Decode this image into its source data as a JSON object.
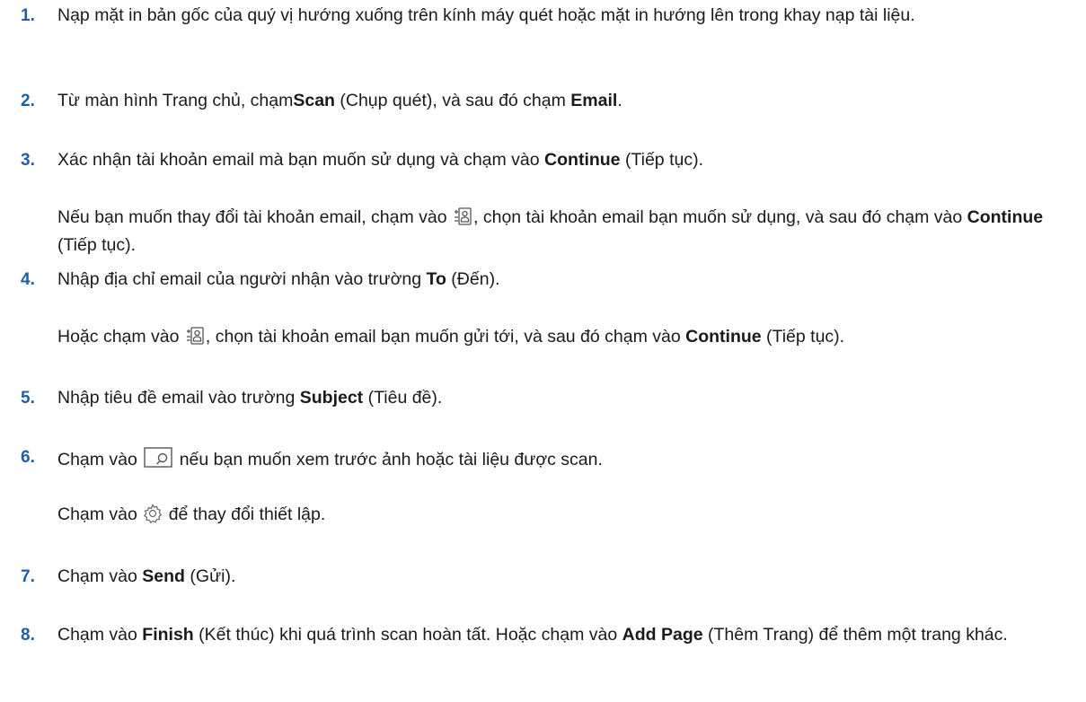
{
  "steps": [
    {
      "number": "1.",
      "text": "Nạp mặt in bản gốc của quý vị hướng xuống trên kính máy quét hoặc mặt in hướng lên trong khay nạp tài liệu."
    },
    {
      "number": "2.",
      "pre": "Từ màn hình Trang chủ, chạm",
      "scan": "Scan",
      "mid": " (Chụp quét), và sau đó chạm ",
      "email": "Email",
      "post": "."
    },
    {
      "number": "3.",
      "pre": "Xác nhận tài khoản email mà bạn muốn sử dụng và chạm vào ",
      "continue": "Continue",
      "post": " (Tiếp tục).",
      "sub_pre": "Nếu bạn muốn thay đổi tài khoản email, chạm vào ",
      "sub_icon": "contacts-icon",
      "sub_mid": ", chọn tài khoản email bạn muốn sử dụng, và sau đó chạm vào ",
      "sub_continue": "Continue",
      "sub_post": " (Tiếp tục)."
    },
    {
      "number": "4.",
      "pre": "Nhập địa chỉ email của người nhận vào trường ",
      "to": "To",
      "post": " (Đến).",
      "sub_pre": "Hoặc chạm vào ",
      "sub_icon": "contacts-icon",
      "sub_mid": ", chọn tài khoản email bạn muốn gửi tới, và sau đó chạm vào ",
      "sub_continue": "Continue",
      "sub_post": " (Tiếp tục)."
    },
    {
      "number": "5.",
      "pre": "Nhập tiêu đề email vào trường ",
      "subject": "Subject",
      "post": " (Tiêu đề)."
    },
    {
      "number": "6.",
      "pre": "Chạm vào ",
      "icon": "preview-icon",
      "post": " nếu bạn muốn xem trước ảnh hoặc tài liệu được scan.",
      "sub_pre": "Chạm vào ",
      "sub_icon": "gear-icon",
      "sub_post": " để thay đổi thiết lập."
    },
    {
      "number": "7.",
      "pre": "Chạm vào ",
      "send": "Send",
      "post": " (Gửi)."
    },
    {
      "number": "8.",
      "pre": "Chạm vào ",
      "finish": "Finish",
      "mid": " (Kết thúc) khi quá trình scan hoàn tất. Hoặc chạm vào ",
      "add_page": "Add Page",
      "post": " (Thêm Trang) để thêm một trang khác."
    }
  ],
  "colors": {
    "number": "#1f5fa8",
    "text": "#1a1a1a"
  }
}
